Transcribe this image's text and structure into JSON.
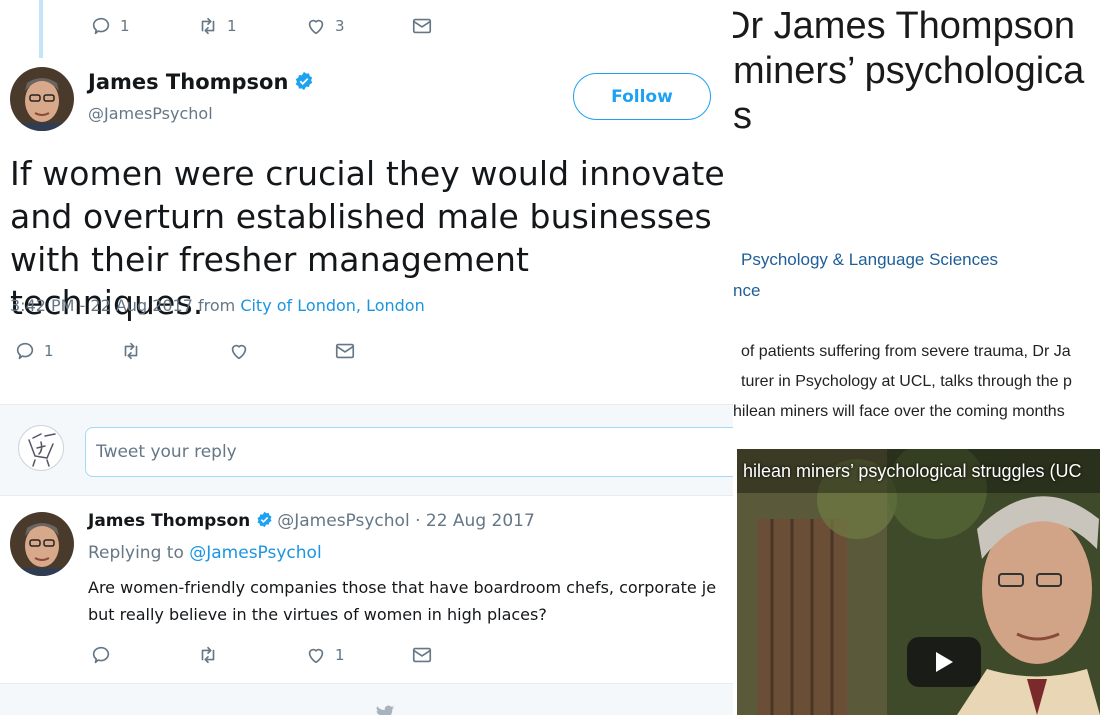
{
  "top_actions": {
    "reply_count": "1",
    "retweet_count": "1",
    "like_count": "3"
  },
  "tweet": {
    "author_name": "James Thompson",
    "author_handle": "@JamesPsychol",
    "follow_label": "Follow",
    "text": "If women were crucial they would innovate and overturn established male businesses with their fresher management techniques.",
    "timestamp": "3:42 PM - 22 Aug 2017 from ",
    "location": "City of London, London",
    "reply_count": "1"
  },
  "reply_box": {
    "placeholder": "Tweet your reply"
  },
  "reply": {
    "author_name": "James Thompson",
    "author_handle_date": "@JamesPsychol · 22 Aug 2017",
    "replying_prefix": "Replying to ",
    "replying_to": "@JamesPsychol",
    "text_line1": "Are women-friendly companies those that have boardroom chefs, corporate je",
    "text_line2": "but really believe in the virtues of women in high places?",
    "like_count": "1"
  },
  "article": {
    "title_line1": "Dr James Thompson",
    "title_line2": "miners’ psychologica",
    "title_line3": "s",
    "dept_line1": "Psychology & Language Sciences",
    "dept_line2": "nce",
    "body_line1": "of patients suffering from severe trauma, Dr Ja",
    "body_line2": "turer in Psychology at UCL, talks through the p",
    "body_line3": "hilean miners will face over the coming months",
    "video_title": "hilean miners’ psychological struggles (UC"
  },
  "colors": {
    "twitter_blue": "#1da1f2",
    "link_blue": "#1b95e0",
    "muted": "#657786",
    "ucl_link": "#1f5e96"
  }
}
